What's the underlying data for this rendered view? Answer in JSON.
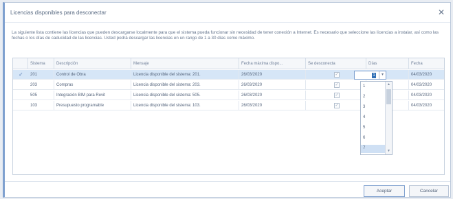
{
  "window": {
    "title": "Licencias disponibles para desconectar"
  },
  "description": "La siguiente lista contiene las licencias que pueden descargarse localmente para que el sistema pueda funcionar sin necesidad de tener conexión a Internet. Es necesario que seleccione las licencias a instalar, así como las fechas o los días de caducidad de las licencias. Usted podrá descargar las licencias en un rango de 1 a 30 días como máximo.",
  "grid": {
    "columns": [
      "Sistema",
      "Descripción",
      "Mensaje",
      "Fecha máxima dispo...",
      "Se desconecta",
      "Días",
      "Fecha"
    ],
    "rows": [
      {
        "sistema": "201",
        "descripcion": "Control de Obra",
        "mensaje": "Licencia disponible del sistema: 201.",
        "fecha_max": "26/03/2020",
        "desconecta": true,
        "dias": "",
        "fecha": "04/03/2020",
        "selected": true
      },
      {
        "sistema": "203",
        "descripcion": "Compras",
        "mensaje": "Licencia disponible del sistema: 203.",
        "fecha_max": "26/03/2020",
        "desconecta": true,
        "dias": "",
        "fecha": "04/03/2020",
        "selected": false
      },
      {
        "sistema": "505",
        "descripcion": "Integración BIM para Revit",
        "mensaje": "Licencia disponible del sistema: 505.",
        "fecha_max": "26/03/2020",
        "desconecta": true,
        "dias": "",
        "fecha": "04/03/2020",
        "selected": false
      },
      {
        "sistema": "103",
        "descripcion": "Presupuesto programable",
        "mensaje": "Licencia disponible del sistema: 103.",
        "fecha_max": "26/03/2020",
        "desconecta": true,
        "dias": "",
        "fecha": "04/03/2020",
        "selected": false
      }
    ]
  },
  "days_dropdown": {
    "current": "1",
    "options": [
      "1",
      "2",
      "3",
      "4",
      "5",
      "6",
      "7"
    ],
    "highlighted": "7"
  },
  "buttons": {
    "accept": "Aceptar",
    "cancel": "Cancelar"
  },
  "icons": {
    "close": "close-icon",
    "row_marker": "pencil-icon",
    "dropdown": "chevron-down-icon"
  }
}
